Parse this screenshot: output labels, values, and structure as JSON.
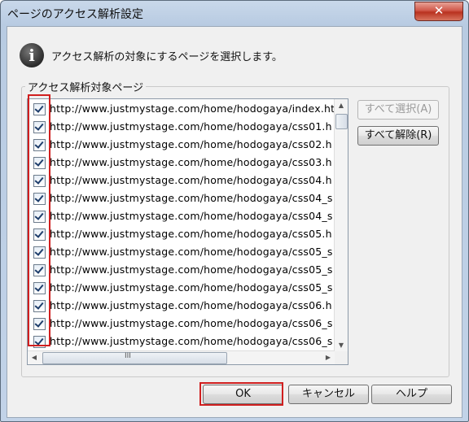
{
  "window": {
    "title": "ページのアクセス解析設定",
    "close_label": "✕"
  },
  "info": {
    "message": "アクセス解析の対象にするページを選択します。"
  },
  "group": {
    "label": "アクセス解析対象ページ"
  },
  "pages": [
    {
      "url": "http://www.justmystage.com/home/hodogaya/index.ht",
      "checked": true
    },
    {
      "url": "http://www.justmystage.com/home/hodogaya/css01.h",
      "checked": true
    },
    {
      "url": "http://www.justmystage.com/home/hodogaya/css02.h",
      "checked": true
    },
    {
      "url": "http://www.justmystage.com/home/hodogaya/css03.h",
      "checked": true
    },
    {
      "url": "http://www.justmystage.com/home/hodogaya/css04.h",
      "checked": true
    },
    {
      "url": "http://www.justmystage.com/home/hodogaya/css04_s",
      "checked": true
    },
    {
      "url": "http://www.justmystage.com/home/hodogaya/css04_s",
      "checked": true
    },
    {
      "url": "http://www.justmystage.com/home/hodogaya/css05.h",
      "checked": true
    },
    {
      "url": "http://www.justmystage.com/home/hodogaya/css05_s",
      "checked": true
    },
    {
      "url": "http://www.justmystage.com/home/hodogaya/css05_s",
      "checked": true
    },
    {
      "url": "http://www.justmystage.com/home/hodogaya/css05_s",
      "checked": true
    },
    {
      "url": "http://www.justmystage.com/home/hodogaya/css06.h",
      "checked": true
    },
    {
      "url": "http://www.justmystage.com/home/hodogaya/css06_s",
      "checked": true
    },
    {
      "url": "http://www.justmystage.com/home/hodogaya/css06_s",
      "checked": true
    }
  ],
  "side_buttons": {
    "select_all": "すべて選択(A)",
    "deselect_all": "すべて解除(R)"
  },
  "buttons": {
    "ok": "OK",
    "cancel": "キャンセル",
    "help": "ヘルプ"
  },
  "hscroll_grip": "III"
}
